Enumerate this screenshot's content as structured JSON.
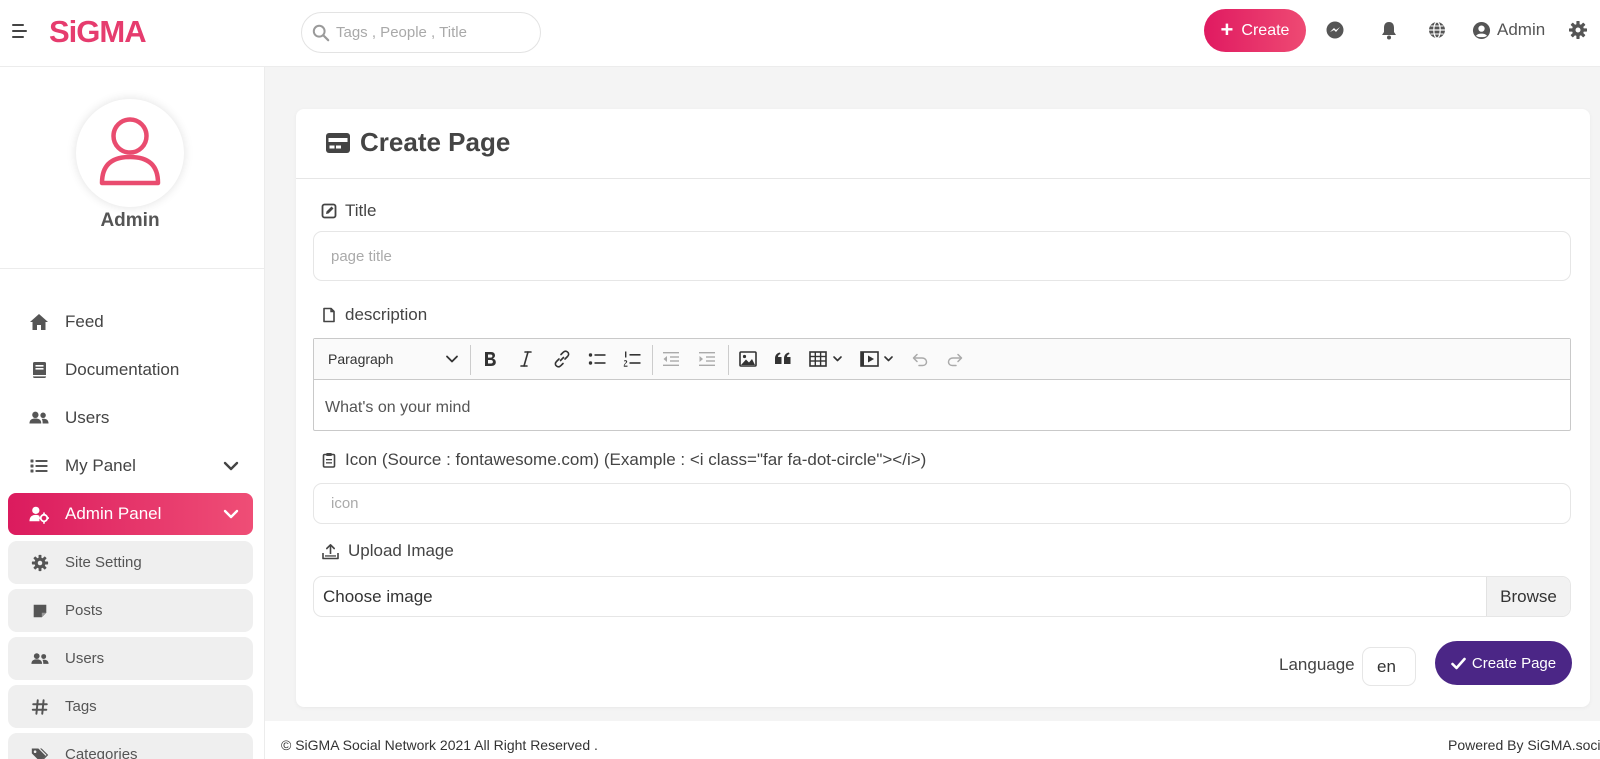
{
  "header": {
    "logo": "SiGMA",
    "search_placeholder": "Tags , People , Title",
    "create_label": "Create",
    "user_label": "Admin",
    "accent": "#e8336a"
  },
  "sidebar": {
    "profile_name": "Admin",
    "nav": [
      {
        "label": "Feed",
        "icon": "home-icon"
      },
      {
        "label": "Documentation",
        "icon": "book-icon"
      },
      {
        "label": "Users",
        "icon": "users-icon"
      },
      {
        "label": "My Panel",
        "icon": "list-icon"
      },
      {
        "label": "Admin Panel",
        "icon": "user-cog-icon"
      }
    ],
    "sub": [
      {
        "label": "Site Setting",
        "icon": "gear-icon"
      },
      {
        "label": "Posts",
        "icon": "note-icon"
      },
      {
        "label": "Users",
        "icon": "users-icon"
      },
      {
        "label": "Tags",
        "icon": "hashtag-icon"
      },
      {
        "label": "Categories",
        "icon": "tags-icon"
      }
    ]
  },
  "form": {
    "title": "Create Page",
    "title_label": "Title",
    "title_placeholder": "page title",
    "description_label": "description",
    "editor": {
      "block_format": "Paragraph",
      "placeholder": "What's on your mind"
    },
    "icon_label": "Icon (Source : fontawesome.com) (Example : <i class=\"far fa-dot-circle\"></i>)",
    "icon_placeholder": "icon",
    "upload_label": "Upload Image",
    "file_label": "Choose image",
    "browse_label": "Browse",
    "language_label": "Language",
    "language_value": "en",
    "submit_label": "Create Page",
    "submit_color": "#4b2686"
  },
  "footer": {
    "left": "© SiGMA Social Network 2021 All Right Reserved .",
    "right": "Powered By SiGMA.social"
  }
}
